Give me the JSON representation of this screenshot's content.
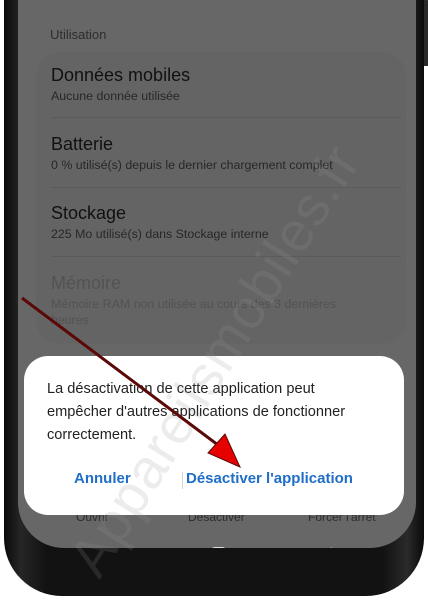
{
  "settings": {
    "section_header": "Utilisation",
    "rows": [
      {
        "title": "Données mobiles",
        "subtitle": "Aucune donnée utilisée"
      },
      {
        "title": "Batterie",
        "subtitle": "0 % utilisé(s) depuis le dernier chargement complet"
      },
      {
        "title": "Stockage",
        "subtitle": "225 Mo utilisé(s) dans Stockage interne"
      },
      {
        "title": "Mémoire",
        "subtitle": "Mémoire RAM non utilisée au cours des 3 dernières heures"
      }
    ],
    "bottom_buttons": [
      "Ouvrir",
      "Désactiver",
      "Forcer l'arrêt"
    ]
  },
  "dialog": {
    "message": "La désactivation de cette application peut empêcher d'autres applications de fonctionner correctement.",
    "cancel_label": "Annuler",
    "confirm_label": "Désactiver l'application"
  },
  "navbar": {
    "icons": [
      "recent-apps-icon",
      "home-icon",
      "back-icon"
    ]
  },
  "watermark": "Appareilsmobiles.fr",
  "colors": {
    "accent": "#1f6ec7",
    "dim_background": "#676767",
    "dialog_background": "#ffffff",
    "annotation_arrow": "#6b0a0a"
  }
}
